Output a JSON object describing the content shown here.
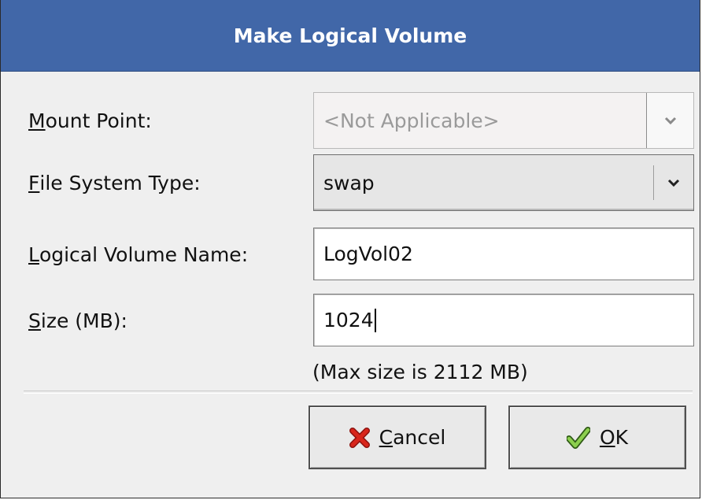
{
  "dialog": {
    "title": "Make Logical Volume"
  },
  "fields": {
    "mount_point": {
      "label_first": "M",
      "label_rest": "ount Point:",
      "value": "<Not Applicable>",
      "enabled": false
    },
    "fs_type": {
      "label_first": "F",
      "label_rest": "ile System Type:",
      "value": "swap"
    },
    "lv_name": {
      "label_first": "L",
      "label_rest": "ogical Volume Name:",
      "value": "LogVol02"
    },
    "size": {
      "label_first": "S",
      "label_rest": "ize (MB):",
      "value": "1024"
    }
  },
  "hint": "(Max size is 2112 MB)",
  "buttons": {
    "cancel": {
      "label_first": "C",
      "label_rest": "ancel",
      "icon": "red-x-icon",
      "color": "#d9261c"
    },
    "ok": {
      "label_first": "O",
      "label_rest": "K",
      "icon": "checkmark-icon",
      "color": "#6fb03a"
    }
  },
  "colors": {
    "titlebar": "#4167a8",
    "dialog_bg": "#efefef"
  }
}
